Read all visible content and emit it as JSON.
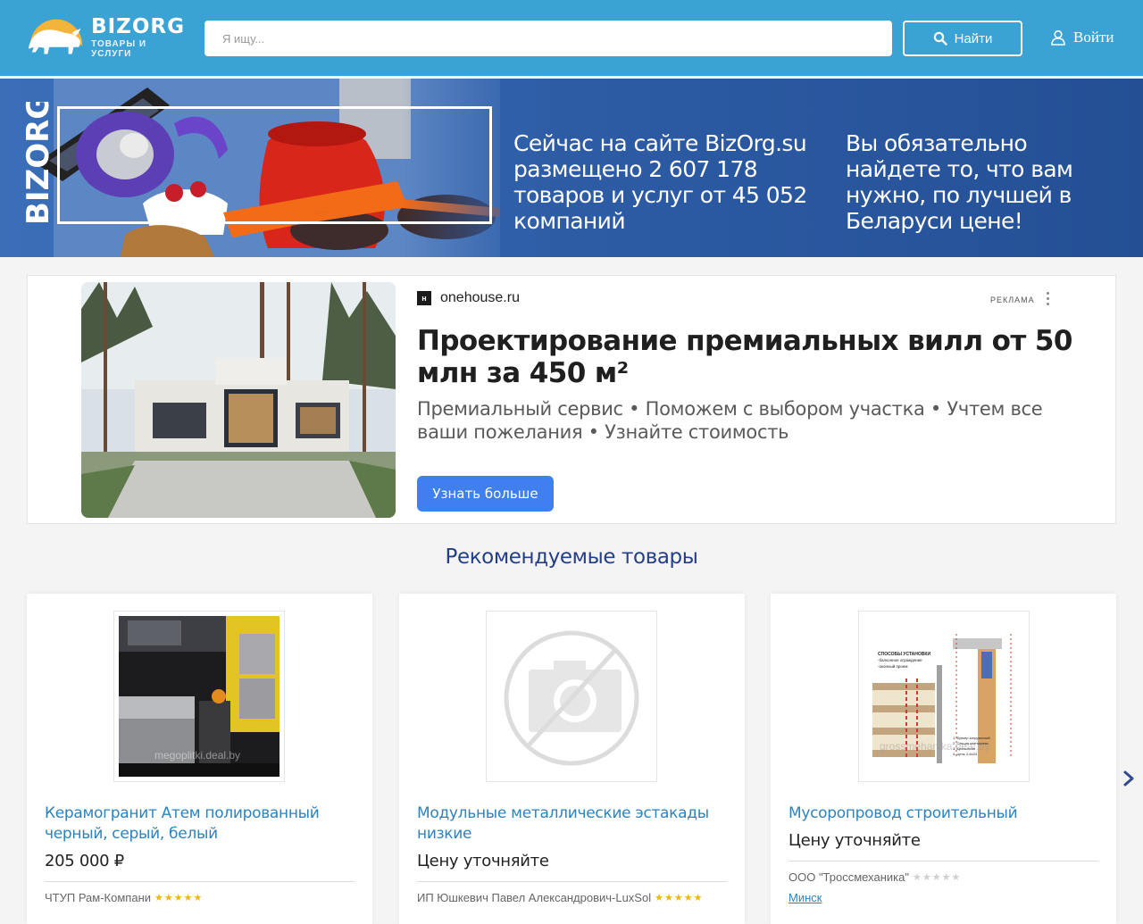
{
  "header": {
    "logo_title": "BIZORG",
    "logo_subtitle": "ТОВАРЫ И УСЛУГИ",
    "search_placeholder": "Я ищу...",
    "search_button": "Найти",
    "login_label": "Войти"
  },
  "banner": {
    "vertical_logo": "BIZORG",
    "text_left": "Сейчас на сайте BizOrg.su размещено 2 607 178 товаров и услуг от 45 052 компаний",
    "text_right": "Вы обязательно найдете то, что вам нужно, по лучшей в Беларуси цене!"
  },
  "ad": {
    "favicon": "н",
    "domain": "onehouse.ru",
    "label": "РЕКЛАМА",
    "title": "Проектирование премиальных вилл от 50 млн за 450 м²",
    "description": "Премиальный сервис • Поможем с выбором участка • Учтем все ваши пожелания • Узнайте стоимость",
    "button": "Узнать больше"
  },
  "recommended": {
    "title": "Рекомендуемые товары",
    "items": [
      {
        "title": "Керамогранит Атем полированный черный, серый, белый",
        "price": "205 000 ₽",
        "seller": "ЧТУП Рам-Компани",
        "rating": 5,
        "watermark": "megoplitki.deal.by"
      },
      {
        "title": "Модульные металлические эстакады низкие",
        "price": "Цену уточняйте",
        "seller": "ИП Юшкевич Павел Александрович-LuxSol",
        "rating": 5
      },
      {
        "title": "Мусоропровод строительный",
        "price": "Цену уточняйте",
        "seller": "ООО \"Троссмеханика\"",
        "rating": 0,
        "city": "Минск",
        "watermark": "grossmehanika.deal.by",
        "image_caption": [
          "СПОСОБЫ УСТАНОВКИ",
          "-балконное ограждение",
          "-оконный проем",
          "1. Бункер загрузочный",
          "2. Секция монтажная",
          "3. Кронштейн",
          "4. Цепь 2-6х24"
        ]
      }
    ]
  },
  "colors": {
    "header_bg": "#3ba3d4",
    "banner_bg": "#2f5fa8",
    "link": "#2c83be",
    "section_title": "#243f88",
    "ad_button": "#3f7ff0",
    "star": "#f0b41c"
  }
}
